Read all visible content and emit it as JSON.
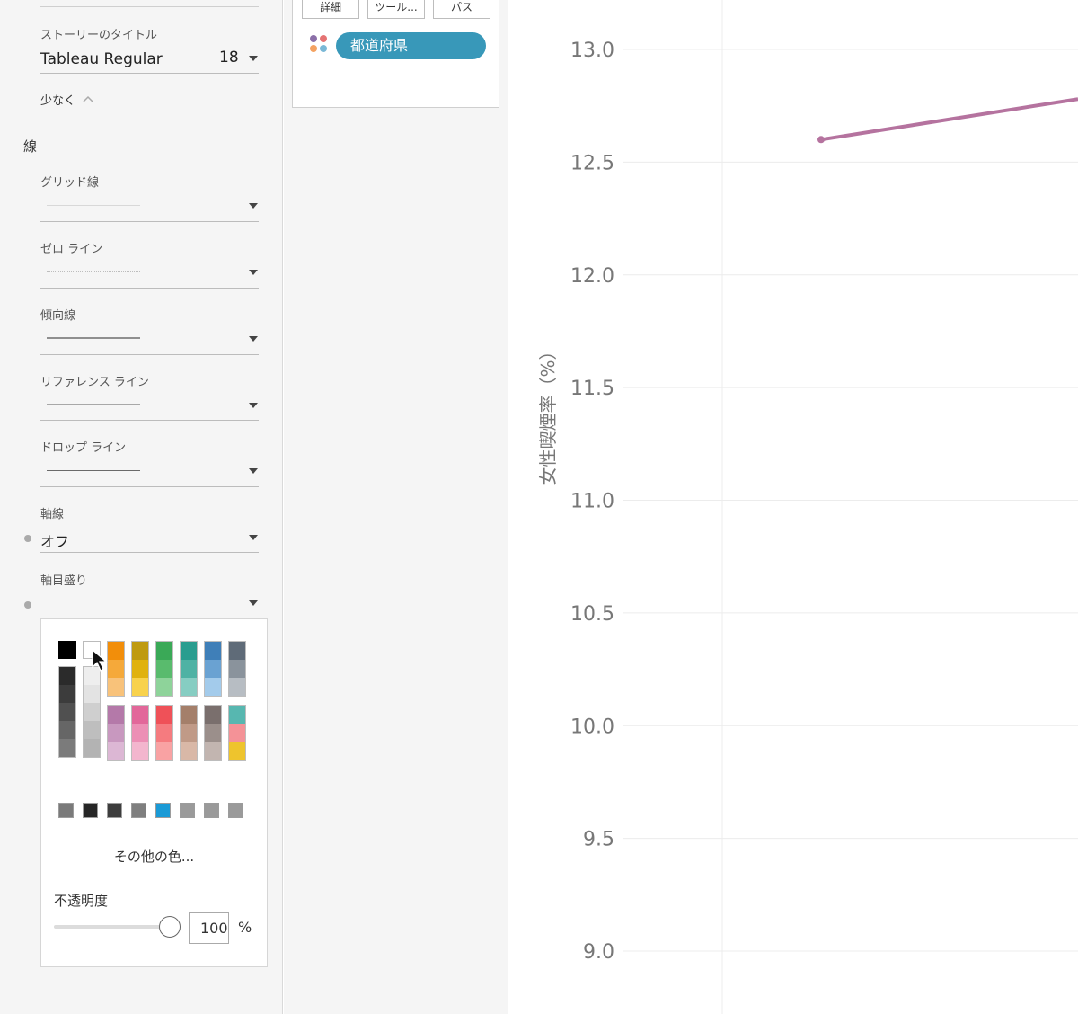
{
  "format_pane": {
    "story_title": {
      "label": "ストーリーのタイトル",
      "font": "Tableau Regular",
      "size": "18"
    },
    "fewer": "少なく",
    "lines_section": "線",
    "grid_lines": {
      "label": "グリッド線"
    },
    "zero_lines": {
      "label": "ゼロ ライン"
    },
    "trend_lines": {
      "label": "傾向線"
    },
    "reference_lines": {
      "label": "リファレンス ライン"
    },
    "drop_lines": {
      "label": "ドロップ ライン"
    },
    "axis_rulers": {
      "label": "軸線",
      "value": "オフ"
    },
    "axis_ticks": {
      "label": "軸目盛り"
    },
    "color_popup": {
      "more_colors": "その他の色...",
      "opacity_label": "不透明度",
      "opacity_value": "100",
      "opacity_unit": "%",
      "opacity_level": 1.0,
      "top_swatches": [
        "#000000",
        "#ffffff"
      ],
      "ramp_row1": [
        [
          "#2b2b2b",
          "#3c3c3c",
          "#505050",
          "#666666",
          "#7b7b7b"
        ],
        [
          "#eeeeee",
          "#e3e3e3",
          "#cfcfcf",
          "#bebebe",
          "#b3b3b3"
        ],
        [
          "#f28e0a",
          "#f5a93a",
          "#f8c27a"
        ],
        [
          "#bf9a10",
          "#e0b20f",
          "#f8d24c"
        ],
        [
          "#3aa957",
          "#59bb6d",
          "#8ed39a"
        ],
        [
          "#2a9d8f",
          "#4fb2a4",
          "#86cdc2"
        ],
        [
          "#3f7fb8",
          "#6aa2d2",
          "#a3cbeb"
        ],
        [
          "#5f6b78",
          "#8a939c",
          "#b7bdc3"
        ]
      ],
      "ramp_row2": [
        [
          "#b479a9",
          "#c898bf",
          "#dcb7d4"
        ],
        [
          "#e2679a",
          "#ec8fb5",
          "#f3b6ce"
        ],
        [
          "#ef5158",
          "#f57b7f",
          "#f9a2a3"
        ],
        [
          "#a47f6a",
          "#c09a87",
          "#d9b8a7"
        ],
        [
          "#7a6f6d",
          "#9b8f8b",
          "#c2b5b0"
        ],
        [
          "#57b7b0",
          "#f49297",
          "#eec42d"
        ]
      ],
      "small_swatches": [
        "#7a7a7a",
        "#262626",
        "#3d3d3d",
        "#7f7f7f",
        "#1a9ad6",
        "#9a9a9a",
        "#9a9a9a",
        "#9a9a9a"
      ]
    }
  },
  "marks_card": {
    "buttons": [
      "詳細",
      "ツール...",
      "パス"
    ],
    "pill": "都道府県",
    "legend_colors": [
      "#8b6fa8",
      "#e57373",
      "#f4a261",
      "#7ab8d6"
    ]
  },
  "chart_data": {
    "type": "line",
    "ylabel": "女性喫煙率（%）",
    "ylim": [
      8.8,
      13.2
    ],
    "yticks": [
      13.0,
      12.5,
      12.0,
      11.5,
      11.0,
      10.5,
      10.0,
      9.5,
      9.0
    ],
    "ytick_labels": [
      "13.0",
      "12.5",
      "12.0",
      "11.5",
      "11.0",
      "10.5",
      "10.0",
      "9.5",
      "9.0"
    ],
    "series": [
      {
        "values": [
          12.6,
          12.78
        ],
        "color": "#b5739f"
      }
    ],
    "grid": true
  }
}
